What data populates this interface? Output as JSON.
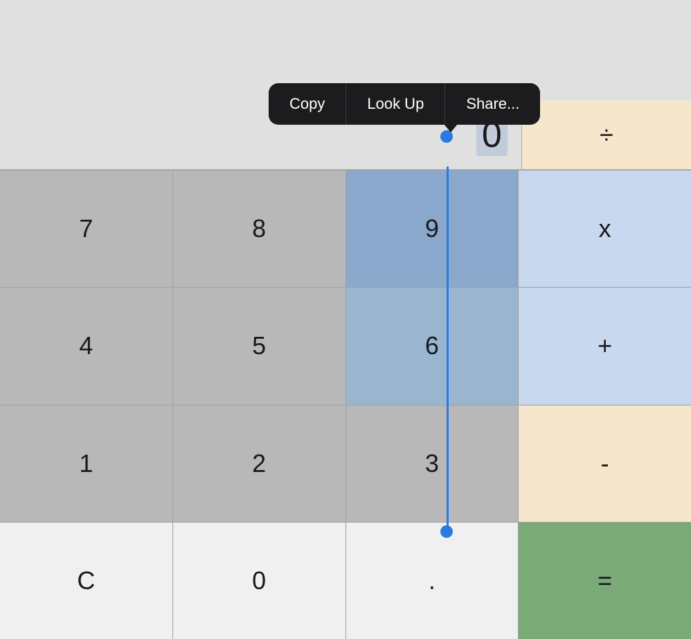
{
  "contextMenu": {
    "items": [
      {
        "id": "copy",
        "label": "Copy"
      },
      {
        "id": "lookup",
        "label": "Look Up"
      },
      {
        "id": "share",
        "label": "Share..."
      }
    ]
  },
  "display": {
    "value": "0",
    "operator": "÷"
  },
  "rows": [
    {
      "cells": [
        {
          "id": "7",
          "label": "7",
          "type": "num"
        },
        {
          "id": "8",
          "label": "8",
          "type": "num"
        },
        {
          "id": "9",
          "label": "9",
          "type": "num-selected"
        },
        {
          "id": "multiply",
          "label": "x",
          "type": "op-blue"
        }
      ]
    },
    {
      "cells": [
        {
          "id": "4",
          "label": "4",
          "type": "num"
        },
        {
          "id": "5",
          "label": "5",
          "type": "num"
        },
        {
          "id": "6",
          "label": "6",
          "type": "num-selected-light"
        },
        {
          "id": "add",
          "label": "+",
          "type": "op-blue"
        }
      ]
    },
    {
      "cells": [
        {
          "id": "1",
          "label": "1",
          "type": "num"
        },
        {
          "id": "2",
          "label": "2",
          "type": "num"
        },
        {
          "id": "3",
          "label": "3",
          "type": "num"
        },
        {
          "id": "subtract",
          "label": "-",
          "type": "op"
        }
      ]
    },
    {
      "cells": [
        {
          "id": "clear",
          "label": "C",
          "type": "white"
        },
        {
          "id": "0",
          "label": "0",
          "type": "white"
        },
        {
          "id": "dot",
          "label": ".",
          "type": "white"
        },
        {
          "id": "equals",
          "label": "=",
          "type": "equals"
        }
      ]
    }
  ]
}
